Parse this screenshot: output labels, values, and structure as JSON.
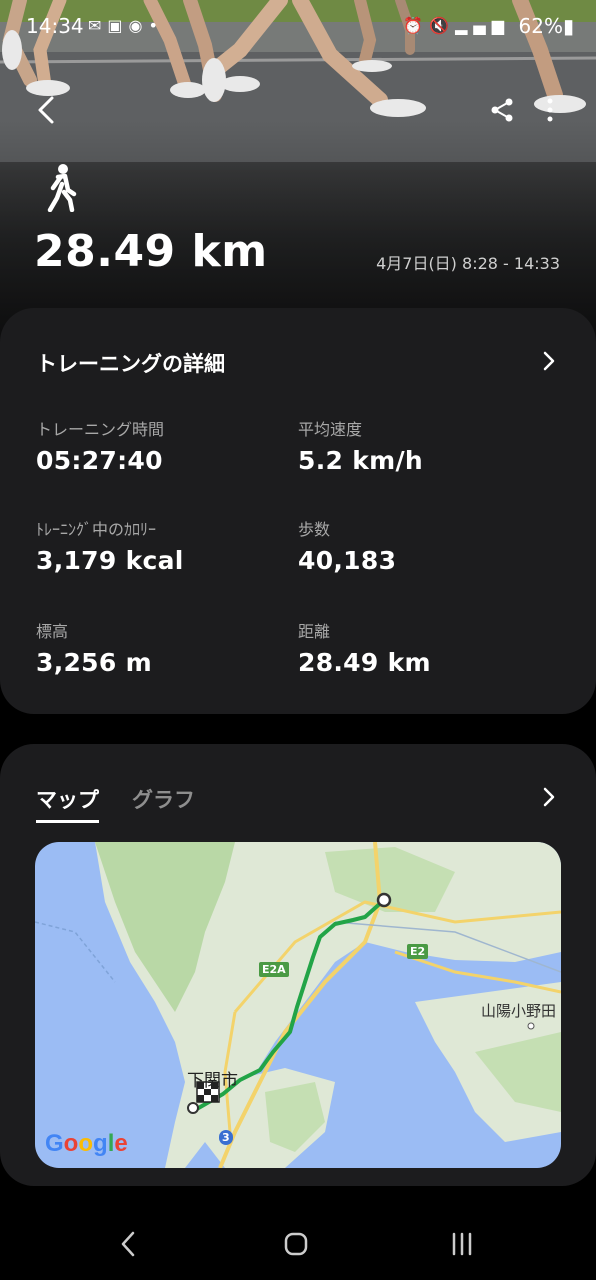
{
  "status_bar": {
    "time": "14:34",
    "battery": "62%",
    "left_icons": [
      "mail-icon",
      "edn-icon",
      "sync-icon",
      "dot-icon"
    ],
    "right_icons": [
      "alarm-icon",
      "mute-icon",
      "5g-icon",
      "signal-icon",
      "battery-icon"
    ]
  },
  "header": {
    "activity_icon": "walking-icon",
    "distance": "28.49 km",
    "date_range": "4月7日(日) 8:28 - 14:33"
  },
  "details": {
    "title": "トレーニングの詳細",
    "stats": [
      {
        "label": "トレーニング時間",
        "value": "05:27:40"
      },
      {
        "label": "平均速度",
        "value": "5.2 km/h"
      },
      {
        "label": "ﾄﾚｰﾆﾝｸﾞ中のｶﾛﾘｰ",
        "value": "3,179 kcal"
      },
      {
        "label": "歩数",
        "value": "40,183"
      },
      {
        "label": "標高",
        "value": "3,256 m"
      },
      {
        "label": "距離",
        "value": "28.49 km"
      }
    ]
  },
  "map_section": {
    "tabs": [
      {
        "label": "マップ",
        "active": true
      },
      {
        "label": "グラフ",
        "active": false
      }
    ],
    "map": {
      "labels": {
        "city": "下関市",
        "town": "山陽小野田"
      },
      "road_shields": {
        "e2a": "E2A",
        "e2": "E2",
        "route3": "3"
      },
      "logo": "Google",
      "route_color": "#22a447",
      "water_color": "#9bbcf4",
      "land_color": "#dfe8d6"
    }
  },
  "colors": {
    "card_bg": "#1c1c1e",
    "label_gray": "#a8a8a8"
  }
}
